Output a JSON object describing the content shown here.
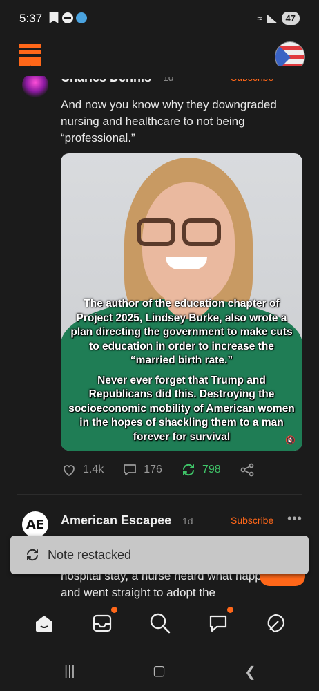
{
  "status": {
    "time": "5:37",
    "battery": "47"
  },
  "post1": {
    "author": "Charles Dennis",
    "time": "1d",
    "subscribe": "Subscribe",
    "text": "And now you know why they downgraded nursing and healthcare to not being “professional.”",
    "image_caption_1": "The author of the education chapter of Project 2025, Lindsey Burke, also wrote a plan directing the government to make cuts to education in order to increase the “married birth rate.”",
    "image_caption_2": "Never ever forget that Trump and Republicans did this. Destroying the socioeconomic mobility of American women in the hopes of shackling them to a man forever for survival",
    "likes": "1.4k",
    "comments": "176",
    "restacks": "798"
  },
  "post2": {
    "avatar_text": "AE",
    "author": "American Escapee",
    "time": "1d",
    "subscribe": "Subscribe",
    "more": "•••",
    "text": "hospital stay, a nurse heard what happened and went straight to adopt the"
  },
  "toast": {
    "text": "Note restacked"
  },
  "colors": {
    "accent": "#ff6719",
    "restack_green": "#3fc468",
    "background": "#1b1b1b"
  }
}
